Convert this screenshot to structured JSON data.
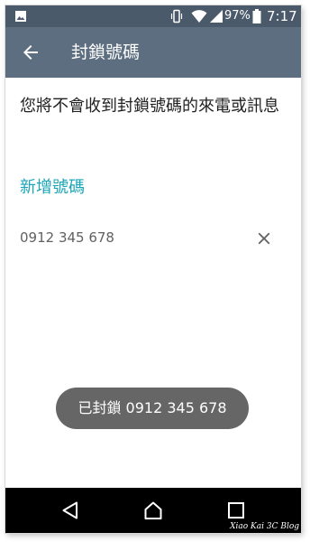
{
  "status_bar": {
    "battery_percent": "97%",
    "time": "7:17",
    "icons": [
      "image-notification-icon",
      "vibrate-icon",
      "wifi-icon",
      "cell-signal-icon",
      "battery-icon"
    ]
  },
  "app_bar": {
    "title": "封鎖號碼",
    "back_icon": "arrow-back-icon"
  },
  "description": "您將不會收到封鎖號碼的來電或訊息",
  "add_number_label": "新增號碼",
  "blocked_numbers": [
    {
      "number": "0912 345 678",
      "remove_icon": "close-icon"
    }
  ],
  "toast": "已封鎖 0912 345 678",
  "nav_bar": {
    "icons": [
      "nav-back-icon",
      "nav-home-icon",
      "nav-recent-icon"
    ]
  },
  "watermark": "Xiao Kai 3C Blog",
  "colors": {
    "status_bar": "#4a5a6a",
    "app_bar": "#5c6e80",
    "accent": "#1aa6b7",
    "toast_bg": "#666666"
  }
}
